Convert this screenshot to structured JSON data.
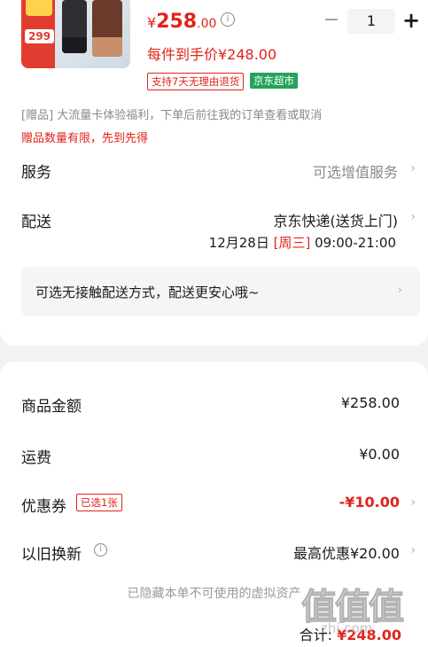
{
  "product": {
    "image_badge_price": "299",
    "price_currency": "¥",
    "price_integer": "258",
    "price_decimal": ".00",
    "per_item_price": "每件到手价¥248.00",
    "tags": [
      "支持7天无理由退货",
      "京东超市"
    ]
  },
  "quantity": {
    "minus": "−",
    "value": "1",
    "plus": "+"
  },
  "gift": {
    "description": "[赠品] 大流量卡体验福利，下单后前往我的订单查看或取消",
    "limit": "赠品数量有限，先到先得"
  },
  "service": {
    "label": "服务",
    "value": "可选增值服务"
  },
  "delivery": {
    "label": "配送",
    "method": "京东快递(送货上门)",
    "date": "12月28日",
    "weekday": "[周三]",
    "time": "09:00-21:00",
    "contactless_text": "可选无接触配送方式，配送更安心哦~"
  },
  "summary": {
    "goods_amount_label": "商品金额",
    "goods_amount_value": "¥258.00",
    "shipping_label": "运费",
    "shipping_value": "¥0.00",
    "coupon_label": "优惠券",
    "coupon_badge": "已选1张",
    "coupon_value": "-¥10.00",
    "tradein_label": "以旧换新",
    "tradein_value": "最高优惠¥20.00",
    "hidden_note": "已隐藏本单不可使用的虚拟资产",
    "total_label": "合计:",
    "total_value": "¥248.00"
  },
  "watermark": {
    "text": "值值值",
    "sub": "zhi.com"
  },
  "colors": {
    "accent_red": "#e2231a",
    "market_green": "#24a35a"
  }
}
